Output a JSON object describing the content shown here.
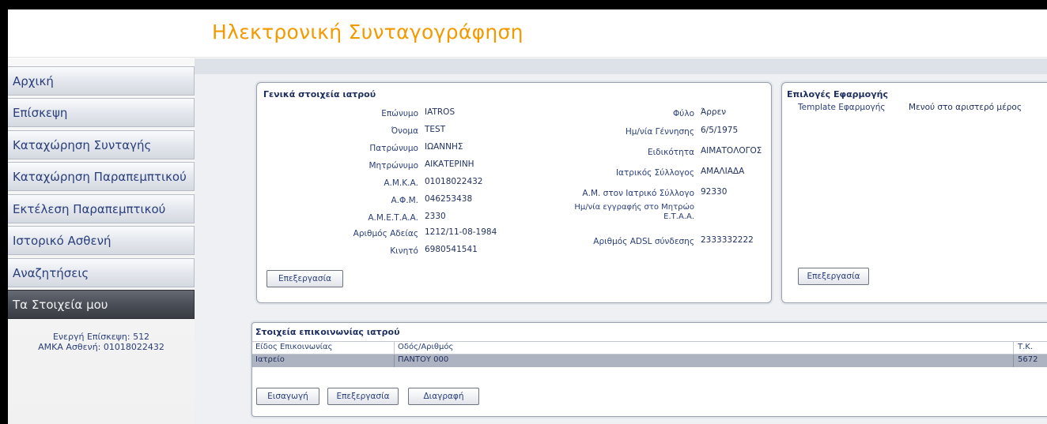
{
  "app_title": "Ηλεκτρονική Συνταγογράφηση",
  "sidebar": {
    "items": [
      {
        "label": "Αρχική"
      },
      {
        "label": "Επίσκεψη"
      },
      {
        "label": "Καταχώρηση Συνταγής"
      },
      {
        "label": "Καταχώρηση Παραπεμπτικού"
      },
      {
        "label": "Εκτέλεση Παραπεμπτικού"
      },
      {
        "label": "Ιστορικό Ασθενή"
      },
      {
        "label": "Αναζητήσεις"
      },
      {
        "label": "Τα Στοιχεία μου"
      }
    ],
    "active_index": 7,
    "session_line1": "Ενεργή Επίσκεψη: 512",
    "session_line2": "ΑΜΚΑ Ασθενή: 01018022432"
  },
  "doctor_panel": {
    "title": "Γενικά στοιχεία ιατρού",
    "left_fields": [
      {
        "label": "Επώνυμο",
        "value": "IATROS"
      },
      {
        "label": "Όνομα",
        "value": "TEST"
      },
      {
        "label": "Πατρώνυμο",
        "value": "ΙΩΑΝΝΗΣ"
      },
      {
        "label": "Μητρώνυμο",
        "value": "ΑΙΚΑΤΕΡΙΝΗ"
      },
      {
        "label": "Α.Μ.Κ.Α.",
        "value": "01018022432"
      },
      {
        "label": "Α.Φ.Μ.",
        "value": "046253438"
      },
      {
        "label": "Α.Μ.Ε.Τ.Α.Α.",
        "value": "2330"
      },
      {
        "label": "Αριθμός Αδείας",
        "value": "1212/11-08-1984"
      },
      {
        "label": "Κινητό",
        "value": "6980541541"
      }
    ],
    "right_fields": [
      {
        "label": "Φύλο",
        "value": "Άρρεν"
      },
      {
        "label": "Ημ/νία Γέννησης",
        "value": "6/5/1975"
      },
      {
        "label": "Ειδικότητα",
        "value": "ΑΙΜΑΤΟΛΟΓΟΣ"
      },
      {
        "label": "Ιατρικός Σύλλογος",
        "value": "ΑΜΑΛΙΑΔΑ"
      },
      {
        "label": "Α.Μ. στον Ιατρικό Σύλλογο",
        "value": "92330"
      },
      {
        "label_line1": "Ημ/νία εγγραφής στο Μητρώο",
        "label_line2": "Ε.Τ.Α.Α.",
        "value": ""
      },
      {
        "label": "Αριθμός ADSL σύνδεσης",
        "value": "2333332222"
      }
    ],
    "edit_label": "Επεξεργασία"
  },
  "options_panel": {
    "title": "Επιλογές Εφαρμογής",
    "field_label": "Template Εφαρμογής",
    "field_value": "Μενού στο αριστερό μέρος",
    "edit_label": "Επεξεργασία"
  },
  "contact_panel": {
    "title": "Στοιχεία επικοινωνίας ιατρού",
    "columns": [
      "Είδος Επικοινωνίας",
      "Οδός/Αριθμός",
      "Τ.Κ."
    ],
    "rows": [
      [
        "Ιατρείο",
        "ΠΑΝΤΟΥ 000",
        "5672"
      ]
    ],
    "buttons": {
      "insert": "Εισαγωγή",
      "edit": "Επεξεργασία",
      "delete": "Διαγραφή"
    }
  },
  "colors": {
    "title_accent": "#f29a00",
    "text_primary": "#2a3f7a",
    "active_nav": "#4a4e57"
  }
}
